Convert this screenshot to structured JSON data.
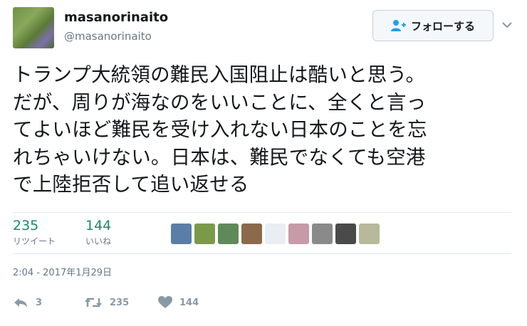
{
  "user": {
    "display_name": "masanorinaito",
    "handle": "@masanorinaito"
  },
  "follow_button": {
    "label": "フォローする",
    "icon": "follow-person-plus-icon"
  },
  "menu_caret": {
    "icon": "chevron-down-icon"
  },
  "tweet": {
    "text": "トランプ大統領の難民入国阻止は酷いと思う。\nだが、周りが海なのをいいことに、全くと言っ\nてよいほど難民を受け入れない日本のことを忘\nれちゃいけない。日本は、難民でなくても空港\nで上陸拒否して追い返せる"
  },
  "stats": {
    "retweets": {
      "count": "235",
      "label": "リツイート"
    },
    "likes": {
      "count": "144",
      "label": "いいね"
    }
  },
  "liker_avatars": [
    {
      "color": "#5a7ea8"
    },
    {
      "color": "#7a9a4a"
    },
    {
      "color": "#5e8a5a"
    },
    {
      "color": "#8a6a4a"
    },
    {
      "color": "#e8eef2"
    },
    {
      "color": "#c79aa8"
    },
    {
      "color": "#8a8a8a"
    },
    {
      "color": "#4a4a4a"
    },
    {
      "color": "#b8b89a"
    }
  ],
  "timestamp": "2:04 - 2017年1月29日",
  "actions": {
    "reply": {
      "count": "3",
      "icon": "reply-icon"
    },
    "retweet": {
      "count": "235",
      "icon": "retweet-icon"
    },
    "like": {
      "count": "144",
      "icon": "heart-icon"
    }
  },
  "colors": {
    "stat_number": "#1b8a63",
    "muted": "#657786",
    "action": "#8899a6",
    "accent": "#1da1f2"
  }
}
